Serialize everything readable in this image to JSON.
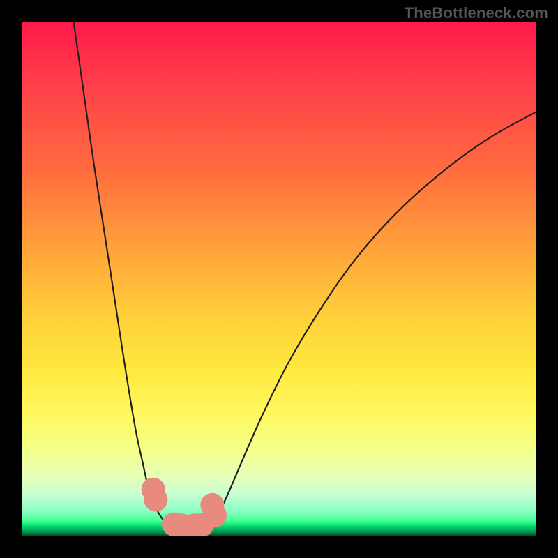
{
  "watermark": "TheBottleneck.com",
  "colors": {
    "background": "#000000",
    "curve": "#231f20",
    "marker": "#e88a7d"
  },
  "chart_data": {
    "type": "line",
    "title": "",
    "xlabel": "",
    "ylabel": "",
    "xlim": [
      0,
      100
    ],
    "ylim": [
      0,
      100
    ],
    "grid": false,
    "legend_position": "none",
    "annotations": [
      "TheBottleneck.com"
    ],
    "series": [
      {
        "name": "left-branch",
        "x": [
          10,
          12,
          14,
          16,
          18,
          20,
          22,
          23.5,
          24.5,
          25.5,
          26.5,
          27.5,
          28.5,
          29.5
        ],
        "y": [
          100,
          86,
          72,
          59,
          46,
          33,
          21,
          14,
          9.5,
          6.5,
          4.5,
          3,
          2.2,
          2
        ]
      },
      {
        "name": "floor",
        "x": [
          29.5,
          31,
          33,
          35,
          36.5
        ],
        "y": [
          2,
          1.8,
          1.8,
          1.9,
          2.1
        ]
      },
      {
        "name": "right-branch",
        "x": [
          36.5,
          38,
          40,
          43,
          47,
          52,
          58,
          65,
          73,
          82,
          91,
          100
        ],
        "y": [
          2.1,
          4,
          8,
          15,
          24,
          34,
          44,
          54,
          63,
          71,
          77.5,
          82.5
        ]
      }
    ],
    "markers": [
      {
        "name": "m1",
        "x": 25.5,
        "y": 9.0,
        "r": 1.5
      },
      {
        "name": "m2",
        "x": 26.0,
        "y": 7.0,
        "r": 1.5
      },
      {
        "name": "m3",
        "x": 37.0,
        "y": 6.0,
        "r": 1.5
      },
      {
        "name": "m4",
        "x": 37.5,
        "y": 4.0,
        "r": 1.5
      },
      {
        "name": "m5",
        "x": 29.5,
        "y": 2.2,
        "r": 1.5
      },
      {
        "name": "m6",
        "x": 31.0,
        "y": 2.0,
        "r": 1.5
      },
      {
        "name": "m7",
        "x": 33.5,
        "y": 2.0,
        "r": 1.5
      },
      {
        "name": "m8",
        "x": 35.0,
        "y": 2.1,
        "r": 1.5
      }
    ]
  }
}
